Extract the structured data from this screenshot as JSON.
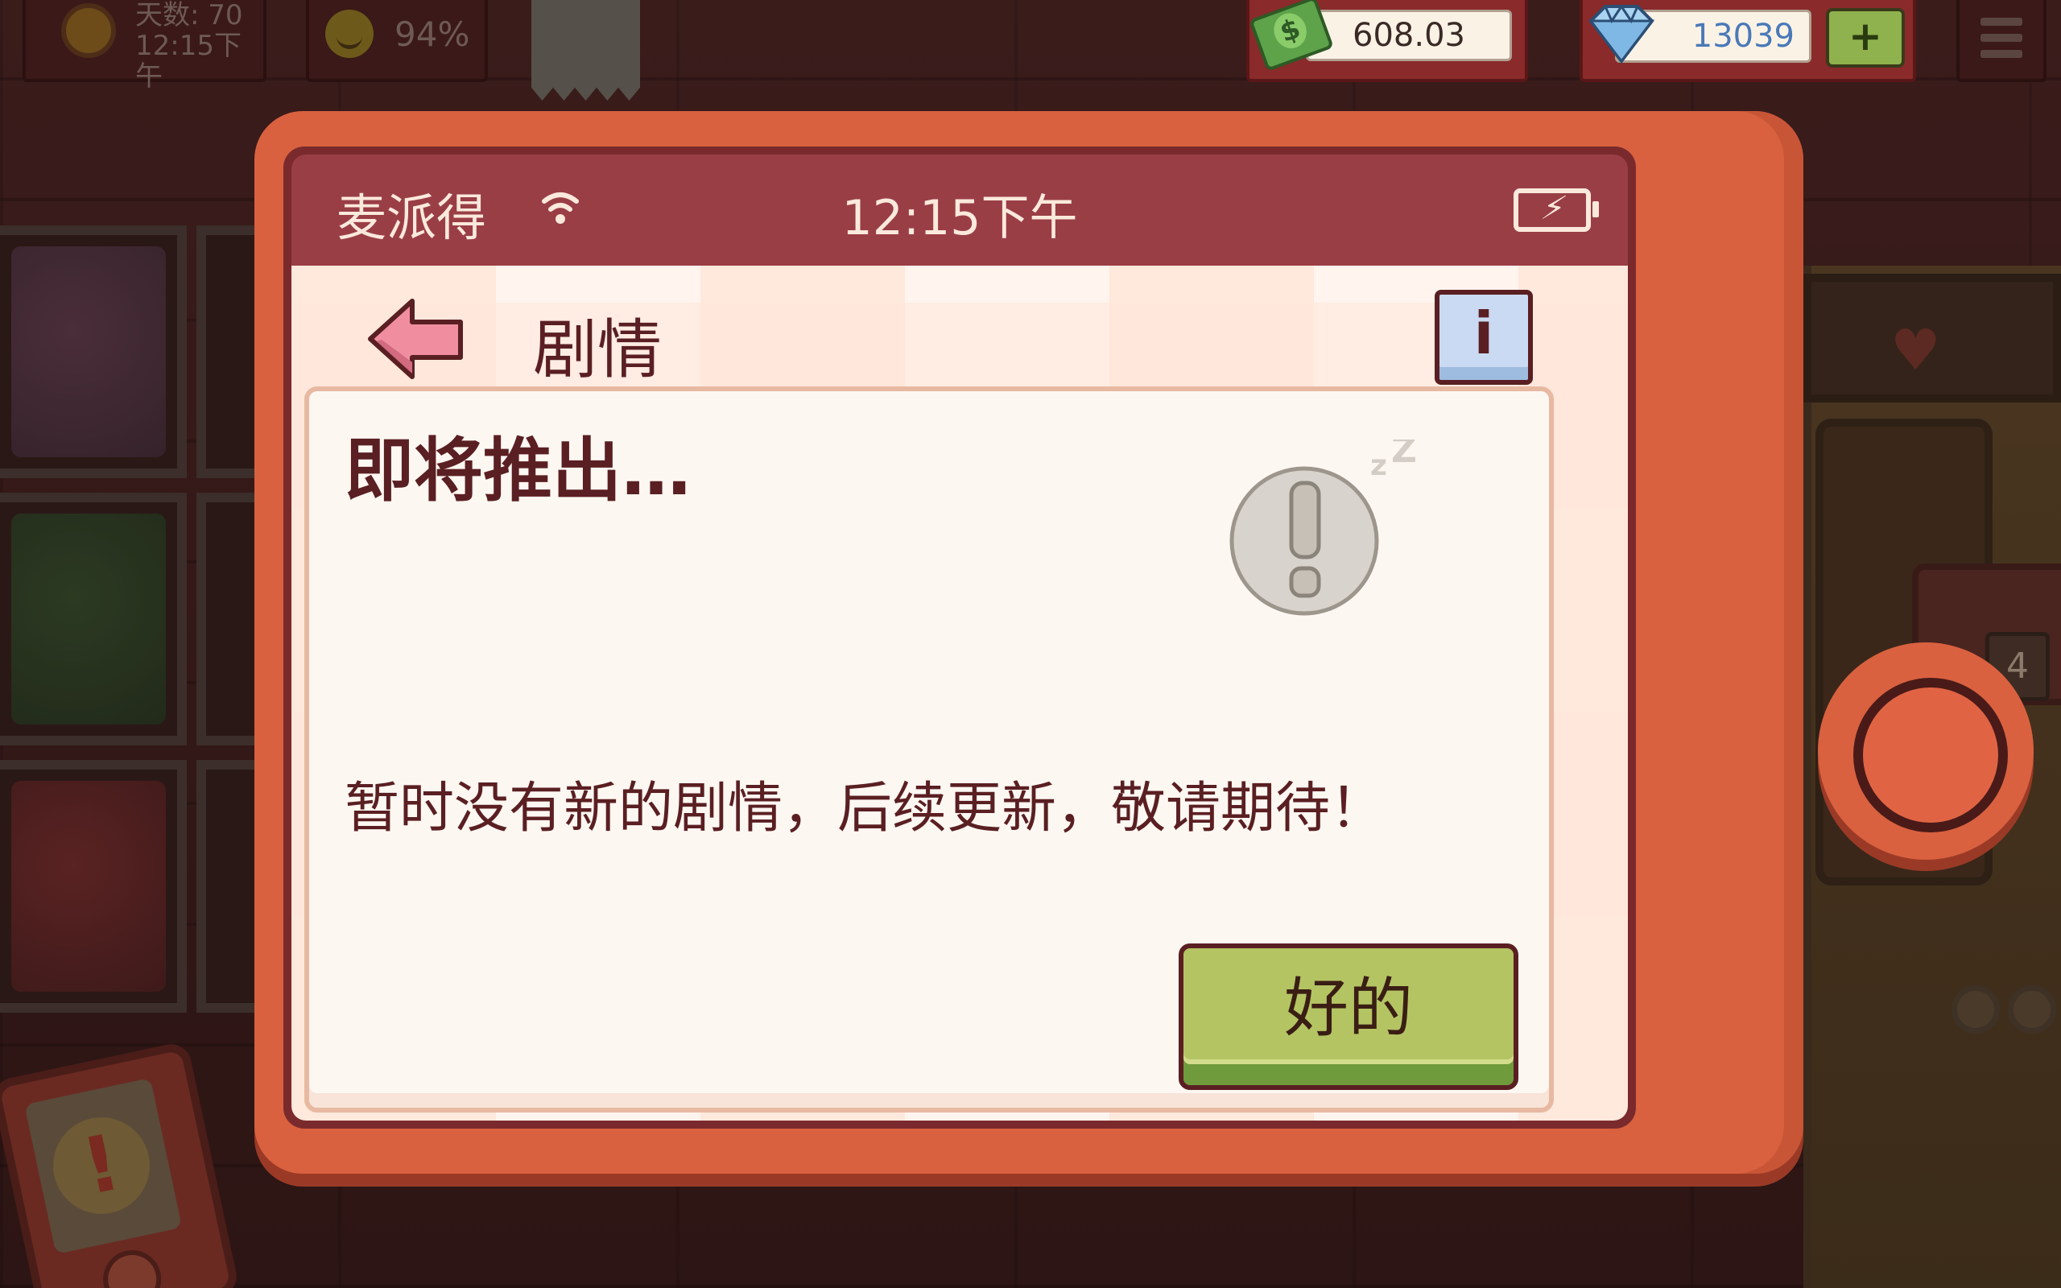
{
  "hud": {
    "day_label": "天数: 70",
    "time": "12:15下午",
    "mood_percent": "94%",
    "money": "608.03",
    "gems": "13039",
    "plus_label": "+"
  },
  "phone": {
    "carrier": "麦派得",
    "clock": "12:15下午",
    "page_title": "剧情",
    "info_label": "i",
    "card_title": "即将推出…",
    "card_message": "暂时没有新的剧情，后续更新，敬请期待！",
    "ok_label": "好的"
  },
  "background": {
    "counter_number": "4"
  },
  "icons": {
    "sun": "sun-icon",
    "mood": "smiley-icon",
    "receipt": "receipt-icon",
    "cash": "cash-icon",
    "gem": "diamond-icon",
    "menu": "hamburger-menu-icon",
    "wifi": "wifi-icon",
    "battery": "battery-charging-icon",
    "back": "back-arrow-icon",
    "sleep": "sleeping-alert-icon"
  },
  "colors": {
    "phone_body": "#d9613f",
    "status_bar": "#9a3e46",
    "text_dark": "#5a1f22",
    "ok_button": "#b4c463",
    "gem_text": "#4a79b8"
  }
}
